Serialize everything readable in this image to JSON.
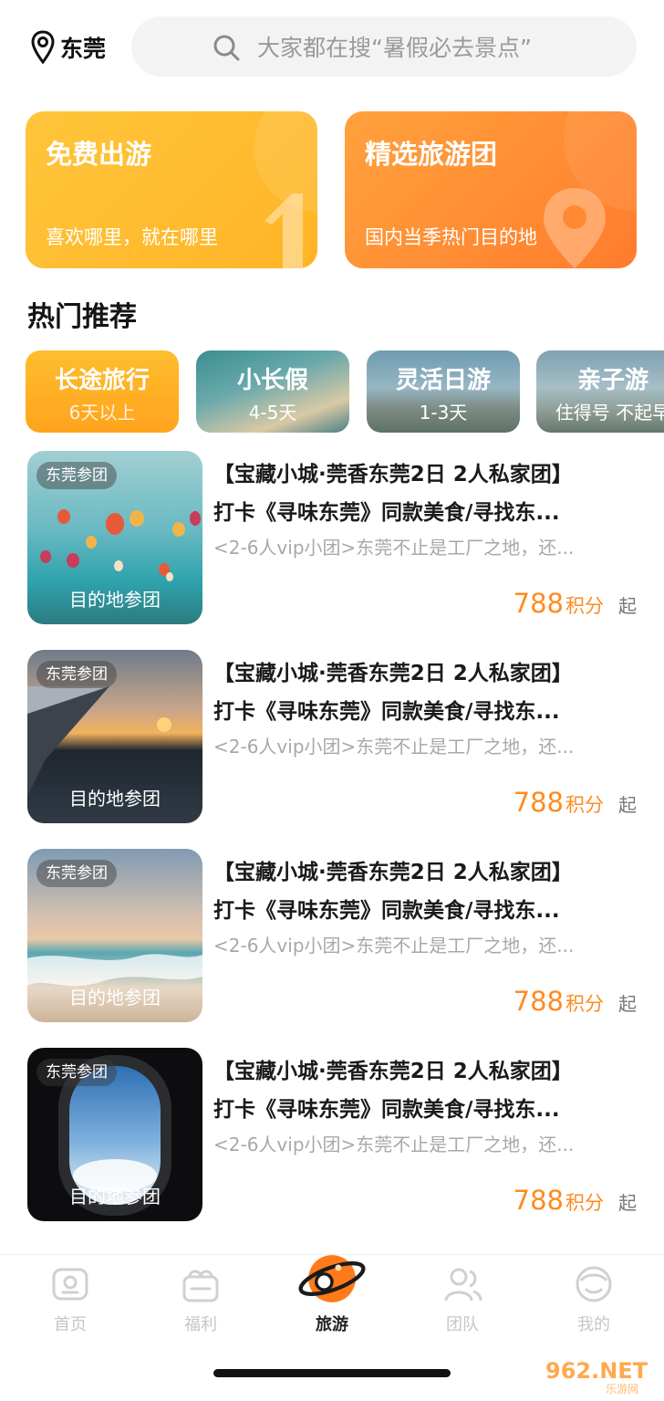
{
  "header": {
    "city": "东莞",
    "search_placeholder": "大家都在搜“暑假必去景点”"
  },
  "promos": [
    {
      "title": "免费出游",
      "subtitle": "喜欢哪里，就在哪里"
    },
    {
      "title": "精选旅游团",
      "subtitle": "国内当季热门目的地"
    }
  ],
  "section_title": "热门推荐",
  "categories": [
    {
      "name": "长途旅行",
      "range": "6天以上"
    },
    {
      "name": "小长假",
      "range": "4-5天"
    },
    {
      "name": "灵活日游",
      "range": "1-3天"
    },
    {
      "name": "亲子游",
      "range": "住得号 不起早"
    }
  ],
  "trips": [
    {
      "badge": "东莞参团",
      "dest": "目的地参团",
      "title_line1": "【宝藏小城·莞香东莞2日 2人私家团】",
      "title_line2": "打卡《寻味东莞》同款美食/寻找东...",
      "desc": "<2-6人vip小团>东莞不止是工厂之地，还...",
      "price": "788",
      "unit": "积分",
      "from": "起"
    },
    {
      "badge": "东莞参团",
      "dest": "目的地参团",
      "title_line1": "【宝藏小城·莞香东莞2日 2人私家团】",
      "title_line2": "打卡《寻味东莞》同款美食/寻找东...",
      "desc": "<2-6人vip小团>东莞不止是工厂之地，还...",
      "price": "788",
      "unit": "积分",
      "from": "起"
    },
    {
      "badge": "东莞参团",
      "dest": "目的地参团",
      "title_line1": "【宝藏小城·莞香东莞2日 2人私家团】",
      "title_line2": "打卡《寻味东莞》同款美食/寻找东...",
      "desc": "<2-6人vip小团>东莞不止是工厂之地，还...",
      "price": "788",
      "unit": "积分",
      "from": "起"
    },
    {
      "badge": "东莞参团",
      "dest": "目的地参团",
      "title_line1": "【宝藏小城·莞香东莞2日 2人私家团】",
      "title_line2": "打卡《寻味东莞》同款美食/寻找东...",
      "desc": "<2-6人vip小团>东莞不止是工厂之地，还...",
      "price": "788",
      "unit": "积分",
      "from": "起"
    }
  ],
  "nav": [
    {
      "label": "首页",
      "icon": "home-icon"
    },
    {
      "label": "福利",
      "icon": "gift-box-icon"
    },
    {
      "label": "旅游",
      "icon": "planet-icon",
      "active": true
    },
    {
      "label": "团队",
      "icon": "team-icon"
    },
    {
      "label": "我的",
      "icon": "profile-icon"
    }
  ],
  "watermark": "962.NET 乐游网",
  "colors": {
    "accent": "#ff8a1f",
    "promo_yellow": "#ffb426",
    "promo_orange": "#ff7c2c"
  }
}
